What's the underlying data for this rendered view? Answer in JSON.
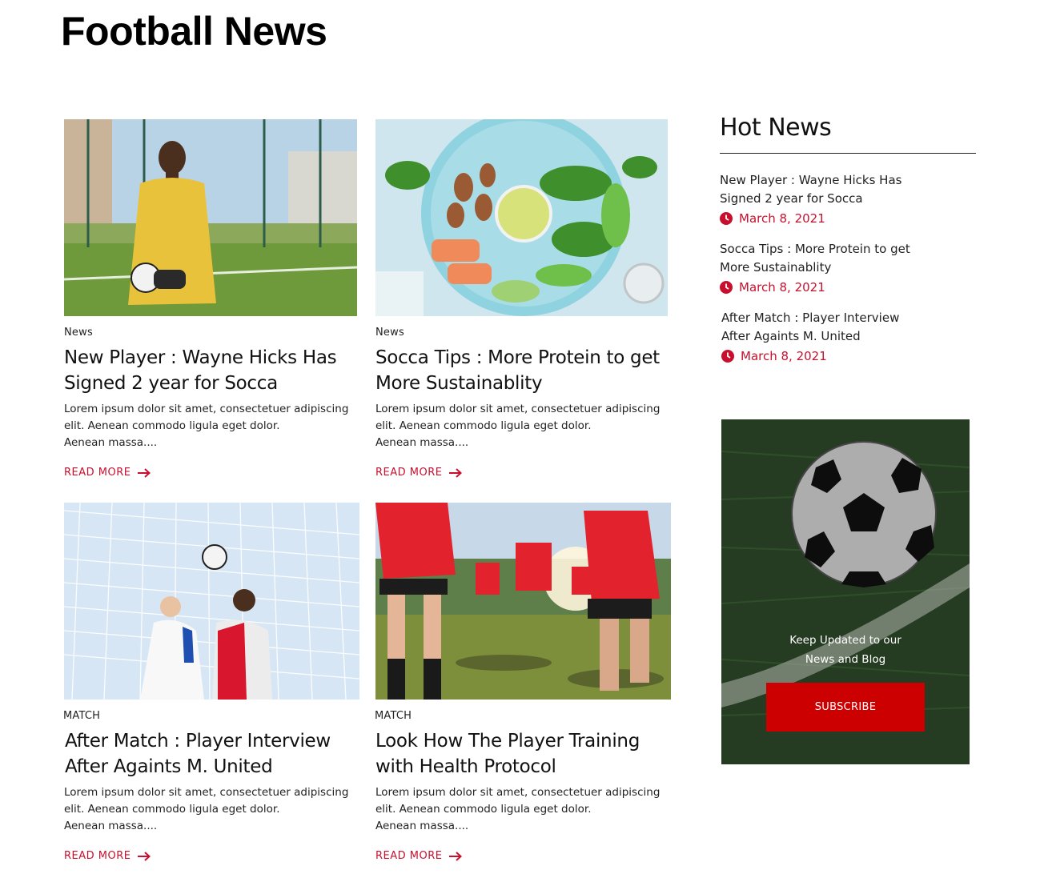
{
  "page": {
    "title": "Football News"
  },
  "colors": {
    "accent": "#c8102e",
    "subscribe_button": "#cc0000",
    "text": "#111111"
  },
  "articles": [
    {
      "category": "News",
      "title": "New Player : Wayne Hicks Has Signed 2 year for Socca",
      "excerpt_lines": [
        "Lorem ipsum dolor sit amet, consectetuer adipiscing",
        "elit. Aenean commodo ligula eget dolor.",
        "Aenean massa...."
      ],
      "read_more": "READ MORE",
      "image": "goalkeeper-photo"
    },
    {
      "category": "News",
      "title": "Socca Tips : More Protein to get More Sustainablity",
      "excerpt_lines": [
        "Lorem ipsum dolor sit amet, consectetuer adipiscing",
        "elit. Aenean commodo ligula eget dolor.",
        "Aenean massa...."
      ],
      "read_more": "READ MORE",
      "image": "healthy-food-photo"
    },
    {
      "category": "MATCH",
      "title": "After Match : Player Interview After Againts M. United",
      "excerpt_lines": [
        "Lorem ipsum dolor sit amet, consectetuer adipiscing",
        "elit. Aenean commodo ligula eget dolor.",
        "Aenean massa...."
      ],
      "read_more": "READ MORE",
      "image": "header-duel-photo"
    },
    {
      "category": "MATCH",
      "title": "Look How The Player Training with Health Protocol",
      "excerpt_lines": [
        "Lorem ipsum dolor sit amet, consectetuer adipiscing",
        "elit. Aenean commodo ligula eget dolor.",
        "Aenean massa...."
      ],
      "read_more": "READ MORE",
      "image": "training-photo"
    }
  ],
  "hot_news": {
    "title": "Hot News",
    "items": [
      {
        "title": "New Player : Wayne Hicks Has Signed 2 year for Socca",
        "date": "March 8, 2021",
        "icon": "clock-icon"
      },
      {
        "title": "Socca Tips : More Protein to get More Sustainablity",
        "date": "March 8, 2021",
        "icon": "clock-icon"
      },
      {
        "title": "After Match : Player Interview After Againts M. United",
        "date": "March 8, 2021",
        "icon": "clock-icon"
      }
    ]
  },
  "subscribe": {
    "line1": "Keep Updated to our",
    "line2": "News and Blog",
    "button": "SUBSCRIBE",
    "image": "soccer-ball-photo"
  }
}
